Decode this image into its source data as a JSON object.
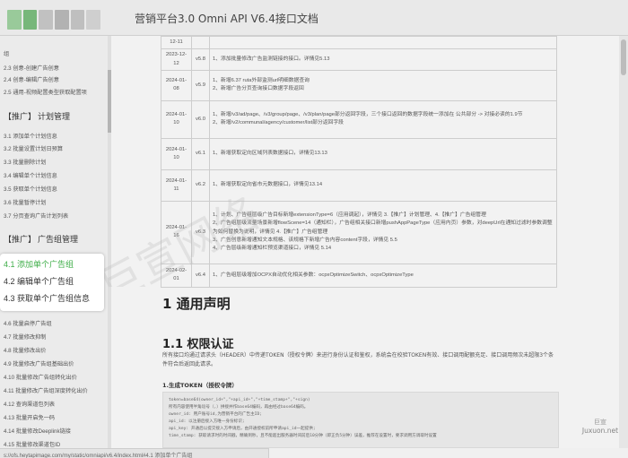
{
  "header": {
    "title": "营销平台3.0 Omni API V6.4接口文档",
    "logo_colors": [
      "#9fd3a0",
      "#7bbf7e",
      "#c9c9c9",
      "#b9b9b9",
      "#c7c7c7",
      "#d8d8d8"
    ]
  },
  "sidebar": {
    "pre_items": [
      "组",
      "2.3 创意-创建广告创意",
      "2.4 创意-编辑广告创意",
      "2.5 通用-视频配置类型获取配置项"
    ],
    "section3": {
      "tag": "【推广】",
      "name": "计划管理"
    },
    "section3_items": [
      "3.1 添加单个计划信息",
      "3.2 批量设置计划日预算",
      "3.3 批量删除计划",
      "3.4 编辑单个计划信息",
      "3.5 获取单个计划信息",
      "3.6 批量暂停计划",
      "3.7 分页查询广告计划列表"
    ],
    "section4": {
      "tag": "【推广】",
      "name": "广告组管理"
    },
    "highlight_items": [
      "4.1 添加单个广告组",
      "4.2 编辑单个广告组",
      "4.3 获取单个广告组信息"
    ],
    "section4_more": [
      "4.6 批量启停广告组",
      "4.7 批量修改抑制",
      "4.8 批量修改出价",
      "4.9 批量修改广告组基础出价",
      "4.10 批量修改广告组转化出价",
      "4.11 批量修改广告组深度转化出价",
      "4.12 查询渠道包列表",
      "4.13 批量开启免一码",
      "4.14 批量修改Deeplink链接",
      "4.15 批量修改渠道包ID"
    ]
  },
  "changelog": [
    {
      "date": "12-11",
      "ver": "",
      "desc": ""
    },
    {
      "date": "2023-12-12",
      "ver": "v5.8",
      "desc": "1、添加批量修改广告监测链接的接口。详情见5.13"
    },
    {
      "date": "2024-01-08",
      "ver": "v5.9",
      "desc": "1、新增6.37 ruta外部监测url明细数据查询|2、新增广告分页查询接口数据字段返回"
    },
    {
      "date": "2024-01-10",
      "ver": "v6.0",
      "desc": "1、新增/v3/ad/page、/v3/group/page、/v3/plan/page部分返回字段，三个接口返回的数据字段统一添加在 公共部分 -> 对接必读的1.9节|2、新增/v2/communal/agency/customer/list部分返回字段"
    },
    {
      "date": "2024-01-10",
      "ver": "v6.1",
      "desc": "1、新增获取定向区域列表数据接口，详情见13.13"
    },
    {
      "date": "2024-01-11",
      "ver": "v6.2",
      "desc": "1、新增获取定向省市元数据接口，详情见13.14"
    },
    {
      "date": "2024-01-16",
      "ver": "v6.3",
      "desc": "1、计划、广告组层级广告目标新增extensionType=6（应用调起），详情见 3.【推广】计划管理、4.【推广】广告组管理|2、广告组层级流量场景新增flowScene=14（通知栏），广告组相关接口新增pushAppPageType（应用内页）参数，对deepUrl在通知过滤时参数调整为如何替换为说明，详情见 4.【推广】广告组管理|3、广告创意新增通知文本规格、该规格下新增广告内容content字段，详情见 5.5|4、广告层级新增通知栏预览渠道接口，详情见 5.14"
    },
    {
      "date": "2024-02-01",
      "ver": "v6.4",
      "desc": "1、广告组层级增加OCPX自动优化相关参数：ocpxOptimizeSwitch、ocpxOptimizeType"
    }
  ],
  "content": {
    "h1": "1 通用声明",
    "h2": "1.1 权限认证",
    "para": "所有接口均通过请求头（HEADER）中传递TOKEN（授权令牌）来进行身份认证和鉴权，系统会在校验TOKEN有效、接口调用配额充足、接口调用频次未超限3个条件符合后返回此请求。",
    "h4": "1.生成TOKEN（授权令牌）",
    "code_lines": [
      "token=base64(owner_id+\",\"+api_id+\",\"+time_stamp+\",\"+sign)",
      "所有内容使用半角逗号（,）拼接并作base64编码，再由经过base64编码。",
      "owner_id: 用户账号id,为营销平台的广告主ID;",
      "api_id: 以注册后接入方唯一身份标识;",
      "api_key: 开通后以提交接入方申请后，由开通授权前所申请api_id一起提供;",
      "time_stamp: 获取请求时的时间戳，精确到秒，且不能超出服务器时间前后10分钟（即正负5分钟）误差，推荐在设置时，要求调用方调取时设置"
    ]
  },
  "status_bar": {
    "url": "s://ofs.heytapimage.com/my/static/omniapi/v6.4/index.html#4.1 添加单个广告组"
  },
  "watermark_text": "巨宣网络",
  "brand": {
    "line1": "巨宣",
    "line2": "Juxuon.net"
  },
  "colors": {
    "active": "#3fae49"
  }
}
